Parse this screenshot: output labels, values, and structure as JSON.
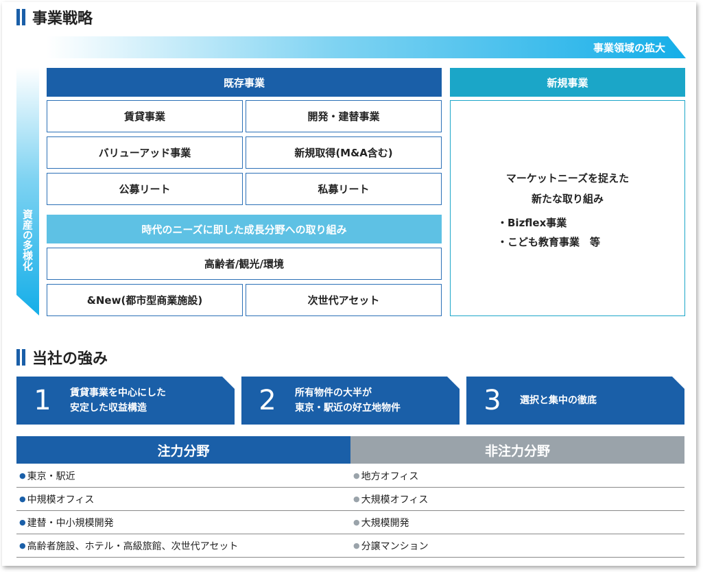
{
  "strategy": {
    "heading": "事業戦略",
    "expansion_label": "事業領域の拡大",
    "diversification_label": "資産の多様化",
    "existing": {
      "header": "既存事業",
      "cells": [
        "賃貸事業",
        "開発・建替事業",
        "バリューアッド事業",
        "新規取得(M&A含む)",
        "公募リート",
        "私募リート"
      ]
    },
    "growth": {
      "header": "時代のニーズに即した成長分野への取り組み",
      "row1": "高齢者/観光/環境",
      "cells": [
        "&New(都市型商業施設)",
        "次世代アセット"
      ]
    },
    "new_business": {
      "header": "新規事業",
      "line1": "マーケットニーズを捉えた",
      "line2": "新たな取り組み",
      "bullet1": "・Bizflex事業",
      "bullet2": "・こども教育事業　等"
    }
  },
  "strengths": {
    "heading": "当社の強み",
    "items": [
      {
        "num": "1",
        "line1": "賃貸事業を中心にした",
        "line2": "安定した収益構造"
      },
      {
        "num": "2",
        "line1": "所有物件の大半が",
        "line2": "東京・駅近の好立地物件"
      },
      {
        "num": "3",
        "line1": "選択と集中の徹底",
        "line2": ""
      }
    ]
  },
  "focus": {
    "focus_header": "注力分野",
    "nonfocus_header": "非注力分野",
    "focus_items": [
      "東京・駅近",
      "中規模オフィス",
      "建替・中小規模開発",
      "高齢者施設、ホテル・高級旅館、次世代アセット"
    ],
    "nonfocus_items": [
      "地方オフィス",
      "大規模オフィス",
      "大規模開発",
      "分譲マンション"
    ]
  },
  "colors": {
    "primary": "#1a5fa8",
    "teal": "#1ba6c8",
    "light": "#5ec1e4",
    "gray": "#9aa3aa"
  }
}
